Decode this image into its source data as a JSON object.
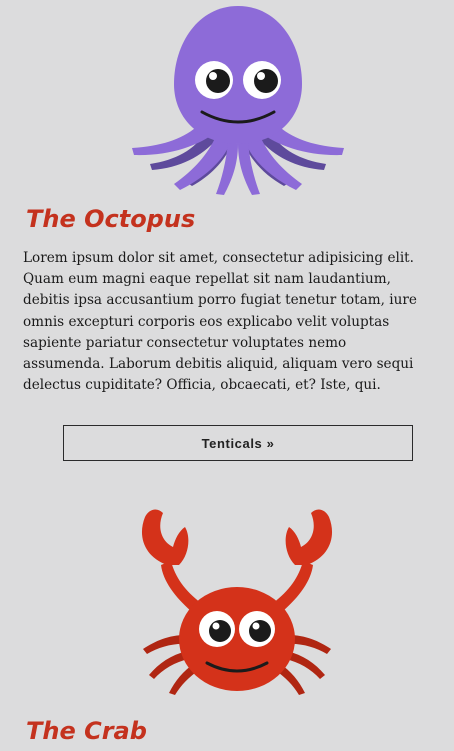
{
  "cards": [
    {
      "title": "The Octopus",
      "image_icon": "octopus-icon",
      "body": "Lorem ipsum dolor sit amet, consectetur adipisicing elit. Quam eum magni eaque repellat sit nam laudantium, debitis ipsa accusantium porro fugiat tenetur totam, iure omnis excepturi corporis eos explicabo velit voluptas sapiente pariatur consectetur voluptates nemo assumenda. Laborum debitis aliquid, aliquam vero sequi delectus cupiditate? Officia, obcaecati, et? Iste, qui.",
      "button_label": "Tenticals »",
      "color": "#8d6bd8"
    },
    {
      "title": "The Crab",
      "image_icon": "crab-icon",
      "color": "#d4321a"
    }
  ],
  "colors": {
    "background": "#dcdcdd",
    "title": "#c4321e",
    "text": "#1a1a1a",
    "button_border": "#2b2b2b"
  }
}
